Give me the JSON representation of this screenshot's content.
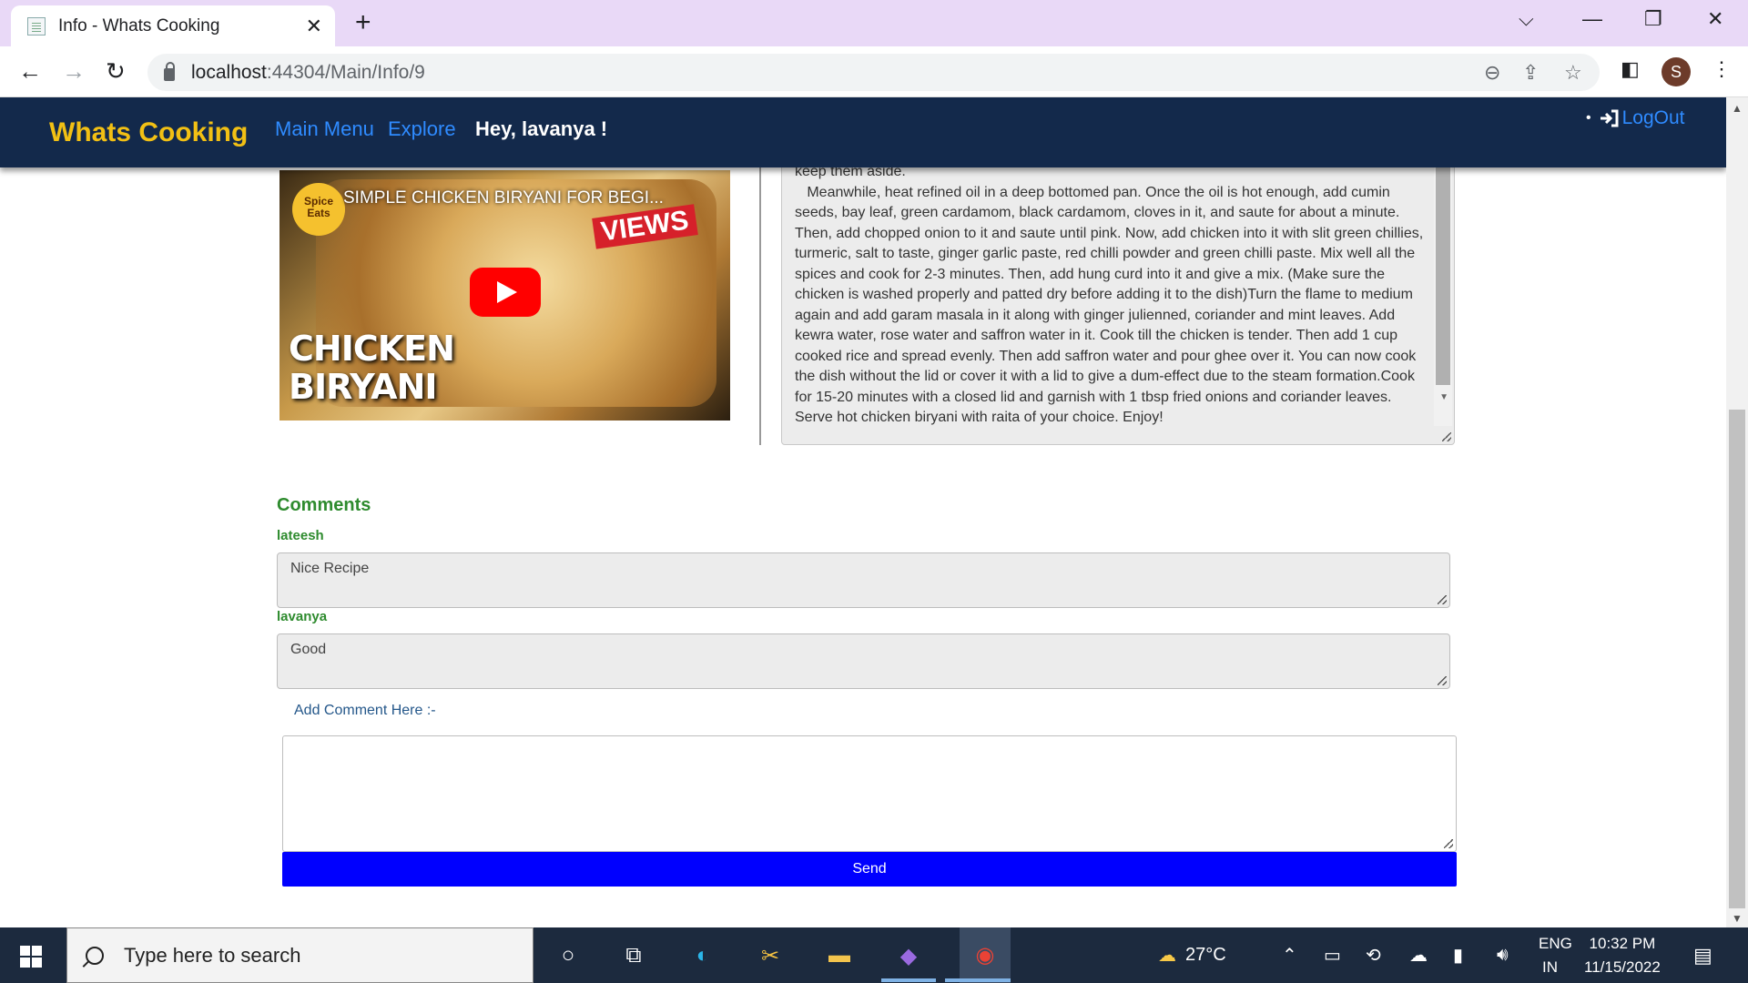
{
  "browser": {
    "tab_title": "Info - Whats Cooking",
    "tab_close": "✕",
    "new_tab": "+",
    "url_host": "localhost",
    "url_path": ":44304/Main/Info/9",
    "profile_initial": "S"
  },
  "site": {
    "brand": "Whats Cooking",
    "nav": {
      "main_menu": "Main Menu",
      "explore": "Explore"
    },
    "greeting": "Hey, lavanya !",
    "logout": "LogOut"
  },
  "video": {
    "channel_badge": "Spice Eats",
    "title": "SIMPLE CHICKEN BIRYANI FOR BEGI...",
    "views_badge": "VIEWS",
    "overlay_line1": "CHICKEN",
    "overlay_line2": "BIRYANI"
  },
  "recipe": {
    "text": "keep them aside.\n   Meanwhile, heat refined oil in a deep bottomed pan. Once the oil is hot enough, add cumin seeds, bay leaf, green cardamom, black cardamom, cloves in it, and saute for about a minute. Then, add chopped onion to it and saute until pink. Now, add chicken into it with slit green chillies, turmeric, salt to taste, ginger garlic paste, red chilli powder and green chilli paste. Mix well all the spices and cook for 2-3 minutes. Then, add hung curd into it and give a mix. (Make sure the chicken is washed properly and patted dry before adding it to the dish)Turn the flame to medium again and add garam masala in it along with ginger julienned, coriander and mint leaves. Add kewra water, rose water and saffron water in it. Cook till the chicken is tender. Then add 1 cup cooked rice and spread evenly. Then add saffron water and pour ghee over it. You can now cook the dish without the lid or cover it with a lid to give a dum-effect due to the steam formation.Cook for 15-20 minutes with a closed lid and garnish with 1 tbsp fried onions and coriander leaves. Serve hot chicken biryani with raita of your choice. Enjoy!"
  },
  "comments": {
    "title": "Comments",
    "items": [
      {
        "user": "lateesh",
        "text": "Nice Recipe"
      },
      {
        "user": "lavanya",
        "text": "Good"
      }
    ],
    "add_label": "Add Comment Here :-",
    "add_value": "",
    "send_label": "Send"
  },
  "taskbar": {
    "search_placeholder": "Type here to search",
    "weather_temp": "27°C",
    "lang_line1": "ENG",
    "lang_line2": "IN",
    "time": "10:32 PM",
    "date": "11/15/2022"
  },
  "colors": {
    "nav_bg": "#13294b",
    "brand": "#f2c014",
    "link": "#2f8bff",
    "comment_green": "#2e8b2e",
    "send_button": "#0000ff"
  }
}
